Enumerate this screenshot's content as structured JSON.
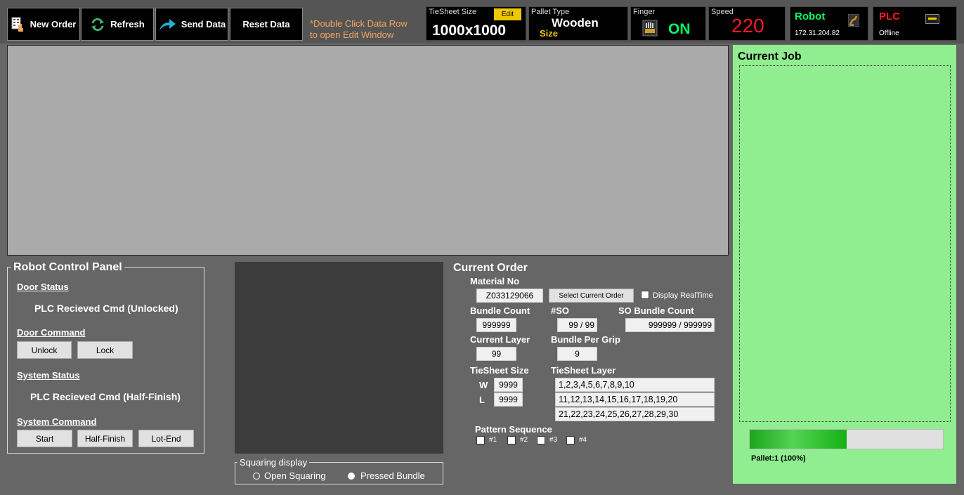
{
  "toolbar": {
    "new_order": "New Order",
    "refresh": "Refresh",
    "send_data": "Send Data",
    "reset_data": "Reset Data",
    "hint_line1": "*Double Click Data Row",
    "hint_line2": "to open Edit Window"
  },
  "status": {
    "tiesheet": {
      "label": "TieSheet Size",
      "edit": "Edit",
      "value": "1000x1000"
    },
    "pallet": {
      "label": "Pallet Type",
      "value": "Wooden",
      "sub": "Size"
    },
    "finger": {
      "label": "Finger",
      "value": "ON"
    },
    "speed": {
      "label": "Speed",
      "value": "220"
    },
    "robot": {
      "label": "Robot",
      "ip": "172.31.204.82"
    },
    "plc": {
      "label": "PLC",
      "state": "Offline"
    }
  },
  "current_job": {
    "title": "Current Job",
    "progress": 1.0,
    "pallet_label": "Pallet:1 (100%)"
  },
  "robot_panel": {
    "title": "Robot Control Panel",
    "door_status_label": "Door Status",
    "door_status_value": "PLC Recieved Cmd (Unlocked)",
    "door_command_label": "Door Command",
    "unlock": "Unlock",
    "lock": "Lock",
    "system_status_label": "System Status",
    "system_status_value": "PLC Recieved Cmd (Half-Finish)",
    "system_command_label": "System Command",
    "start": "Start",
    "half_finish": "Half-Finish",
    "lot_end": "Lot-End"
  },
  "squaring": {
    "title": "Squaring display",
    "option1": "Open Squaring",
    "option2": "Pressed Bundle",
    "selected": "Pressed Bundle"
  },
  "order": {
    "title": "Current Order",
    "material_label": "Material No",
    "material_value": "Z033129066",
    "select_btn": "Select Current Order",
    "realtime_label": "Display RealTime",
    "bundle_count_label": "Bundle Count",
    "bundle_count_value": "999999",
    "so_label": "#SO",
    "so_value": "99 / 99",
    "so_bundle_label": "SO Bundle Count",
    "so_bundle_value": "999999 / 999999",
    "current_layer_label": "Current Layer",
    "current_layer_value": "99",
    "bundle_per_grip_label": "Bundle Per Grip",
    "bundle_per_grip_value": "9",
    "tiesheet_size_label": "TieSheet Size",
    "w_label": "W",
    "w_value": "9999",
    "l_label": "L",
    "l_value": "9999",
    "tiesheet_layer_label": "TieSheet Layer",
    "layers": [
      "1,2,3,4,5,6,7,8,9,10",
      "11,12,13,14,15,16,17,18,19,20",
      "21,22,23,24,25,26,27,28,29,30"
    ],
    "pattern_label": "Pattern Sequence",
    "patterns": [
      "#1",
      "#2",
      "#3",
      "#4"
    ]
  }
}
